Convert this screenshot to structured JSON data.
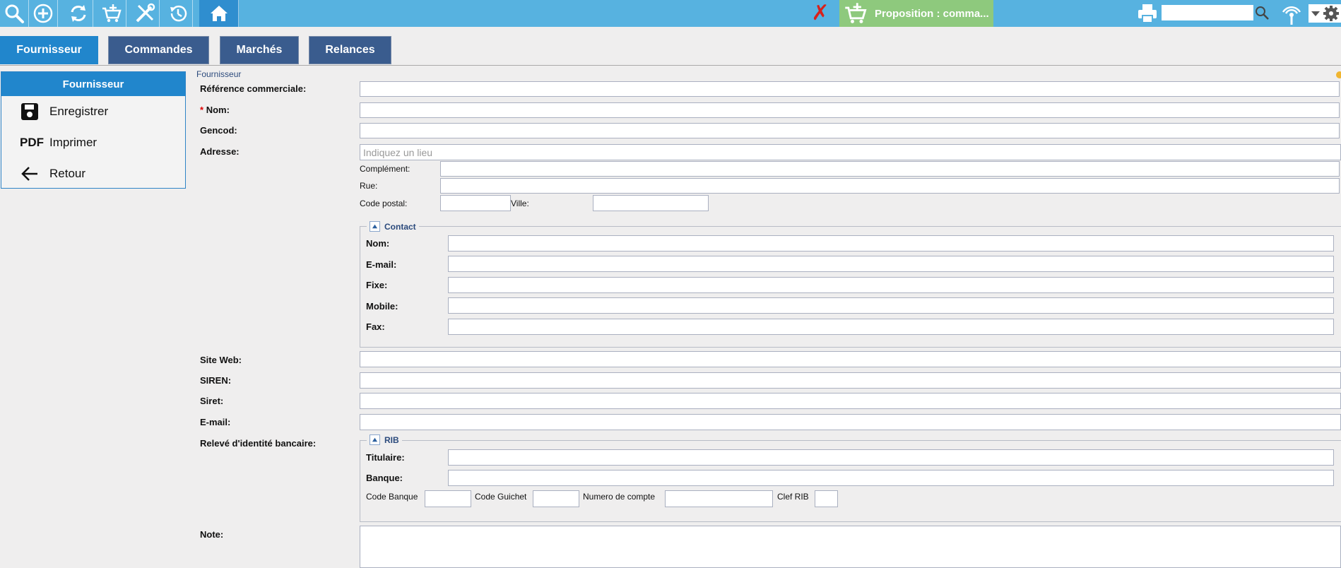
{
  "toolbar": {
    "proposition_label": "Proposition : comma...",
    "search_value": "",
    "colors": {
      "bar": "#57b2e0",
      "home": "#2f8ecf",
      "proposition": "#8ec97d",
      "cancel": "#d8211b"
    }
  },
  "tabs": [
    {
      "label": "Fournisseur",
      "active": true
    },
    {
      "label": "Commandes"
    },
    {
      "label": "Marchés"
    },
    {
      "label": "Relances"
    }
  ],
  "side": {
    "title": "Fournisseur",
    "items": [
      {
        "label": "Enregistrer",
        "icon": "save-icon"
      },
      {
        "label": "Imprimer",
        "icon": "pdf-icon",
        "icon_text": "PDF"
      },
      {
        "label": "Retour",
        "icon": "arrow-left-icon"
      }
    ]
  },
  "form": {
    "section": "Fournisseur",
    "reference_label": "Référence commerciale:",
    "nom_required": "*",
    "nom_label": "Nom:",
    "gencod_label": "Gencod:",
    "adresse_label": "Adresse:",
    "adresse_placeholder": "Indiquez un lieu",
    "complement_label": "Complément:",
    "rue_label": "Rue:",
    "code_postal_label": "Code postal:",
    "ville_label": "Ville:",
    "contact": {
      "legend": "Contact",
      "nom_label": "Nom:",
      "email_label": "E-mail:",
      "fixe_label": "Fixe:",
      "mobile_label": "Mobile:",
      "fax_label": "Fax:"
    },
    "site_web_label": "Site Web:",
    "siren_label": "SIREN:",
    "siret_label": "Siret:",
    "email_label": "E-mail:",
    "rib_label": "Relevé d'identité bancaire:",
    "rib": {
      "legend": "RIB",
      "titulaire_label": "Titulaire:",
      "banque_label": "Banque:",
      "code_banque_label": "Code Banque",
      "code_guichet_label": "Code Guichet",
      "numero_compte_label": "Numero de compte",
      "clef_rib_label": "Clef RIB"
    },
    "note_label": "Note:"
  }
}
